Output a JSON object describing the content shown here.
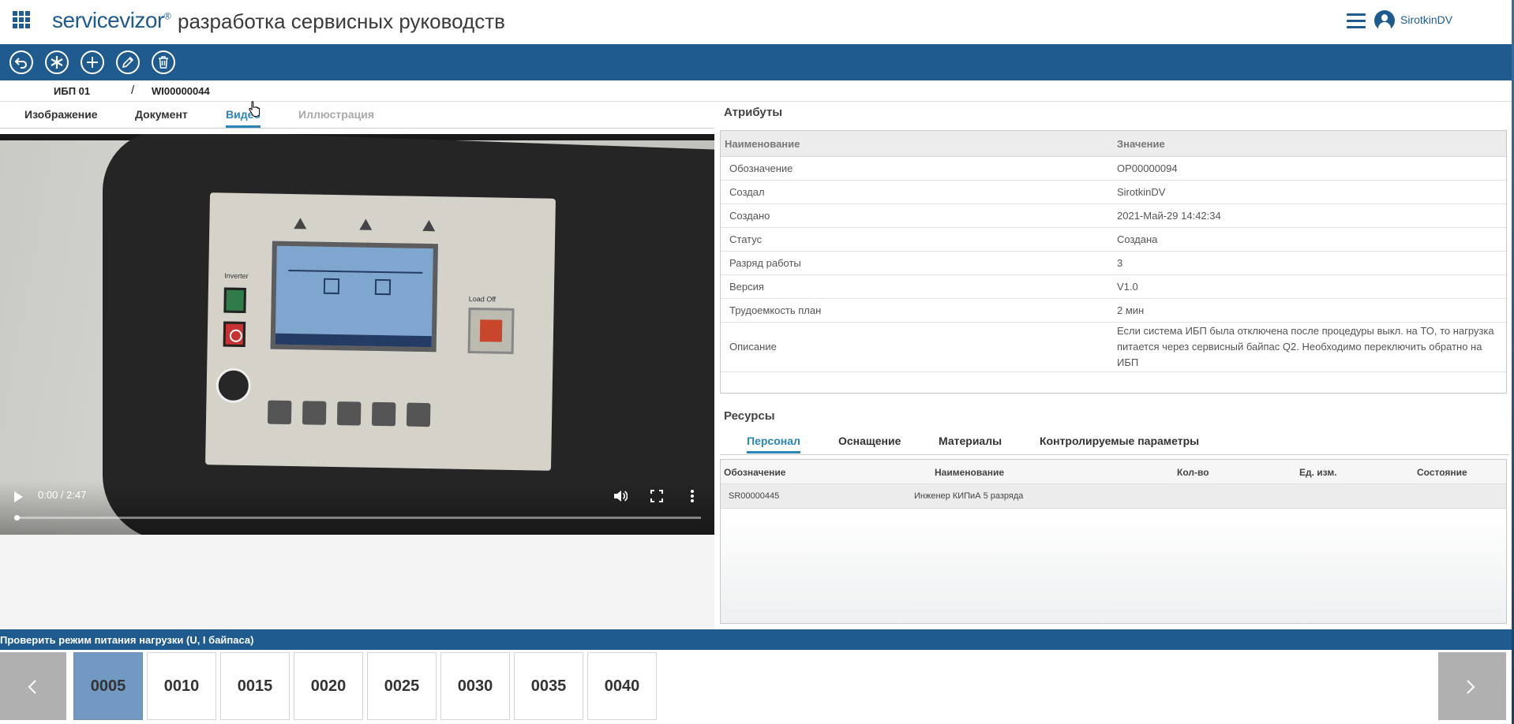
{
  "header": {
    "brand": "servicevizor",
    "brand_mark": "®",
    "title": "разработка сервисных руководств",
    "user": "SirotkinDV"
  },
  "toolbar": {
    "buttons": [
      {
        "name": "back",
        "glyph": "↶"
      },
      {
        "name": "asterisk",
        "glyph": "✱"
      },
      {
        "name": "add",
        "glyph": "+"
      },
      {
        "name": "edit",
        "glyph": "✎"
      },
      {
        "name": "delete",
        "glyph": "🗑"
      }
    ]
  },
  "breadcrumb": {
    "part1": "ИБП 01",
    "separator": "/",
    "part2": "WI00000044"
  },
  "media_tabs": {
    "image": "Изображение",
    "document": "Документ",
    "video": "Видео",
    "illustration": "Иллюстрация"
  },
  "video": {
    "time": "0:00 / 2:47",
    "progress": 0,
    "panel_label_inverter": "Inverter",
    "panel_label_load_off": "Load Off"
  },
  "attributes": {
    "title": "Атрибуты",
    "col_name": "Наименование",
    "col_value": "Значение",
    "rows": [
      {
        "key": "Обозначение",
        "value": "OP00000094"
      },
      {
        "key": "Создал",
        "value": "SirotkinDV"
      },
      {
        "key": "Создано",
        "value": "2021-Май-29 14:42:34"
      },
      {
        "key": "Статус",
        "value": "Создана"
      },
      {
        "key": "Разряд работы",
        "value": "3"
      },
      {
        "key": "Версия",
        "value": "V1.0"
      },
      {
        "key": "Трудоемкость план",
        "value": "2 мин"
      },
      {
        "key": "Описание",
        "value": "Если система ИБП была отключена после процедуры выкл. на ТО, то нагрузка питается через сервисный байпас Q2. Необходимо переключить обратно на ИБП"
      }
    ]
  },
  "resources": {
    "title": "Ресурсы",
    "tabs": {
      "personnel": "Персонал",
      "equipment": "Оснащение",
      "materials": "Материалы",
      "parameters": "Контролируемые параметры"
    },
    "columns": {
      "designation": "Обозначение",
      "name": "Наименование",
      "qty": "Кол-во",
      "unit": "Ед. изм.",
      "state": "Состояние"
    },
    "rows": [
      {
        "designation": "SR00000445",
        "name": "Инженер КИПиА 5 разряда",
        "qty": "",
        "unit": "",
        "state": ""
      }
    ]
  },
  "steps": {
    "title": "Проверить режим питания нагрузки (U, I байпаса)",
    "items": [
      "0005",
      "0010",
      "0015",
      "0020",
      "0025",
      "0030",
      "0035",
      "0040"
    ],
    "active": "0005"
  },
  "colors": {
    "brand_blue": "#1f5b8e",
    "active_tab": "#2a85b8",
    "active_step": "#7199c2"
  }
}
